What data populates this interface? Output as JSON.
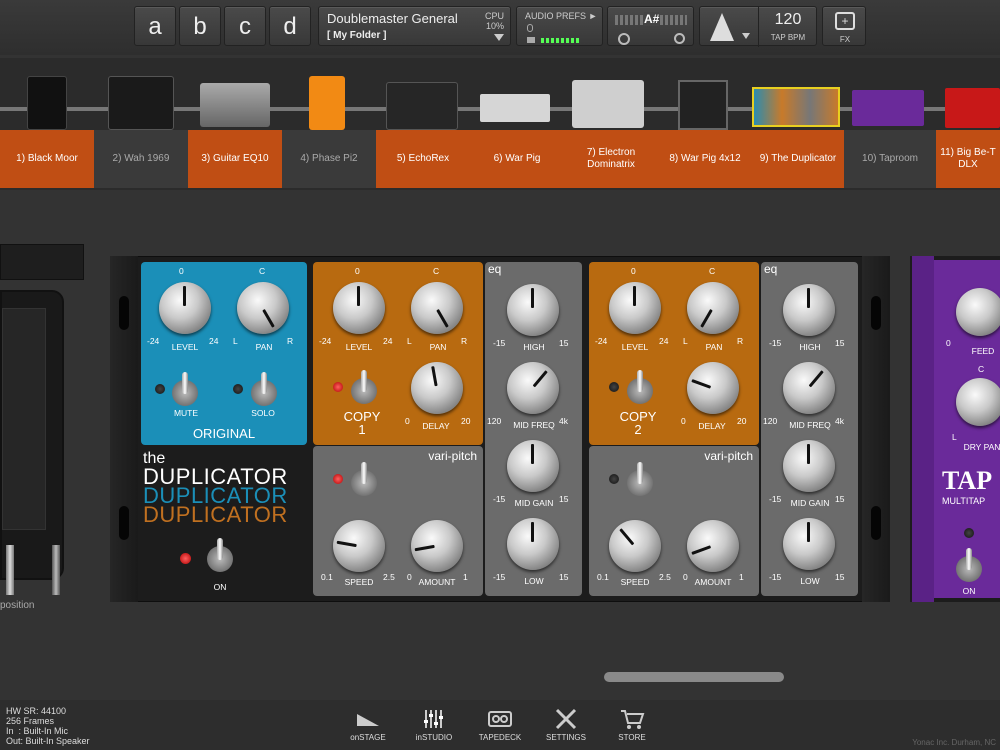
{
  "banks": [
    "a",
    "b",
    "c",
    "d"
  ],
  "preset": {
    "name": "Doublemaster General",
    "folder": "[ My Folder ]",
    "cpu_label": "CPU",
    "cpu_value": "10%"
  },
  "audio_prefs": {
    "label": "AUDIO PREFS ►",
    "input_level": 0.9
  },
  "tuner": {
    "note": "A#"
  },
  "tempo": {
    "bpm": "120",
    "label": "TAP BPM"
  },
  "fx_label": "FX",
  "chain": [
    {
      "label": "1) Black Moor",
      "active": true
    },
    {
      "label": "2) Wah 1969",
      "active": false
    },
    {
      "label": "3) Guitar EQ10",
      "active": true
    },
    {
      "label": "4) Phase Pi2",
      "active": false
    },
    {
      "label": "5) EchoRex",
      "active": true
    },
    {
      "label": "6) War Pig",
      "active": true
    },
    {
      "label": "7) Electron Dominatrix",
      "active": true
    },
    {
      "label": "8) War Pig 4x12",
      "active": true
    },
    {
      "label": "9) The Duplicator",
      "active": true
    },
    {
      "label": "10) Taproom",
      "active": false
    },
    {
      "label": "11) Big Be-T DLX",
      "active": true
    }
  ],
  "left_unit_caption": "position",
  "duplicator": {
    "original": {
      "title": "ORIGINAL",
      "level": {
        "label": "LEVEL",
        "min": "-24",
        "max": "24",
        "top": "0"
      },
      "pan": {
        "label": "PAN",
        "min": "L",
        "max": "R",
        "top": "C"
      },
      "mute": "MUTE",
      "solo": "SOLO"
    },
    "brand": {
      "the": "the",
      "name": "DUPLICATOR"
    },
    "on_label": "ON",
    "copies": [
      {
        "title": "COPY",
        "num": "1",
        "level": "LEVEL",
        "lmin": "-24",
        "lmax": "24",
        "ltop": "0",
        "pan": "PAN",
        "pmin": "L",
        "pmax": "R",
        "ptop": "C",
        "delay": "DELAY",
        "dmin": "0",
        "dmax": "20",
        "vari": "vari-pitch",
        "speed": "SPEED",
        "smin": "0.1",
        "smax": "2.5",
        "amount": "AMOUNT",
        "amin": "0",
        "amax": "1",
        "eq": "eq",
        "high": "HIGH",
        "midfreq": "MID FREQ",
        "mfmin": "120",
        "mfmax": "4k",
        "midgain": "MID GAIN",
        "low": "LOW",
        "emin": "-15",
        "emax": "15"
      },
      {
        "title": "COPY",
        "num": "2",
        "level": "LEVEL",
        "lmin": "-24",
        "lmax": "24",
        "ltop": "0",
        "pan": "PAN",
        "pmin": "L",
        "pmax": "R",
        "ptop": "C",
        "delay": "DELAY",
        "dmin": "0",
        "dmax": "20",
        "vari": "vari-pitch",
        "speed": "SPEED",
        "smin": "0.1",
        "smax": "2.5",
        "amount": "AMOUNT",
        "amin": "0",
        "amax": "1",
        "eq": "eq",
        "high": "HIGH",
        "midfreq": "MID FREQ",
        "mfmin": "120",
        "mfmax": "4k",
        "midgain": "MID GAIN",
        "low": "LOW",
        "emin": "-15",
        "emax": "15"
      }
    ]
  },
  "taproom": {
    "feed": "FEED",
    "drypan": "DRY PAN",
    "zero": "0",
    "c": "C",
    "l": "L",
    "brand": "TAP",
    "sub": "MULTITAP",
    "on": "ON"
  },
  "status": {
    "line1": "HW SR: 44100",
    "line2": "256 Frames",
    "line3": "In  : Built-In Mic",
    "line4": "Out: Built-In Speaker"
  },
  "nav": [
    {
      "label": "onSTAGE"
    },
    {
      "label": "inSTUDIO"
    },
    {
      "label": "TAPEDECK"
    },
    {
      "label": "SETTINGS"
    },
    {
      "label": "STORE"
    }
  ],
  "copyright": "Yonac Inc. Durham, NC"
}
